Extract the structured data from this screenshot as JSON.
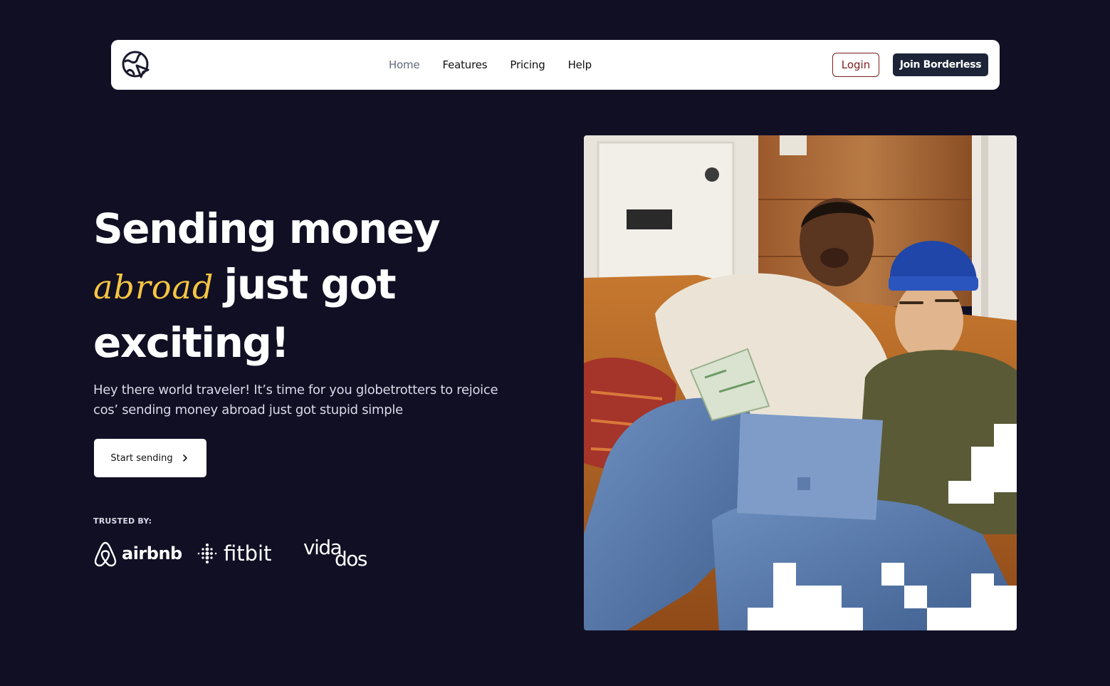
{
  "nav": {
    "logo_icon": "globe-cursor-icon",
    "links": [
      {
        "label": "Home",
        "active": true
      },
      {
        "label": "Features",
        "active": false
      },
      {
        "label": "Pricing",
        "active": false
      },
      {
        "label": "Help",
        "active": false
      }
    ],
    "login_label": "Login",
    "join_label": "Join Borderless"
  },
  "hero": {
    "title_line1": "Sending money",
    "title_accent": "abroad",
    "title_line2_rest": "just got",
    "title_line3": "exciting!",
    "subtitle": "Hey there world traveler! It’s time for you globetrotters to rejoice cos’ sending money abroad just got stupid simple",
    "cta_label": "Start sending",
    "cta_icon": "chevron-right-icon",
    "trusted_label": "TRUSTED BY:",
    "partners": {
      "airbnb": "airbnb",
      "fitbit": "fitbit",
      "vida_top": "vida",
      "vida_bottom": "dos"
    },
    "image_alt": "two-friends-laughing-with-laptop-photo"
  },
  "colors": {
    "background": "#110f24",
    "accent_yellow": "#f5c542",
    "dark_button": "#1d2438",
    "login_border": "#7a1f1f"
  }
}
